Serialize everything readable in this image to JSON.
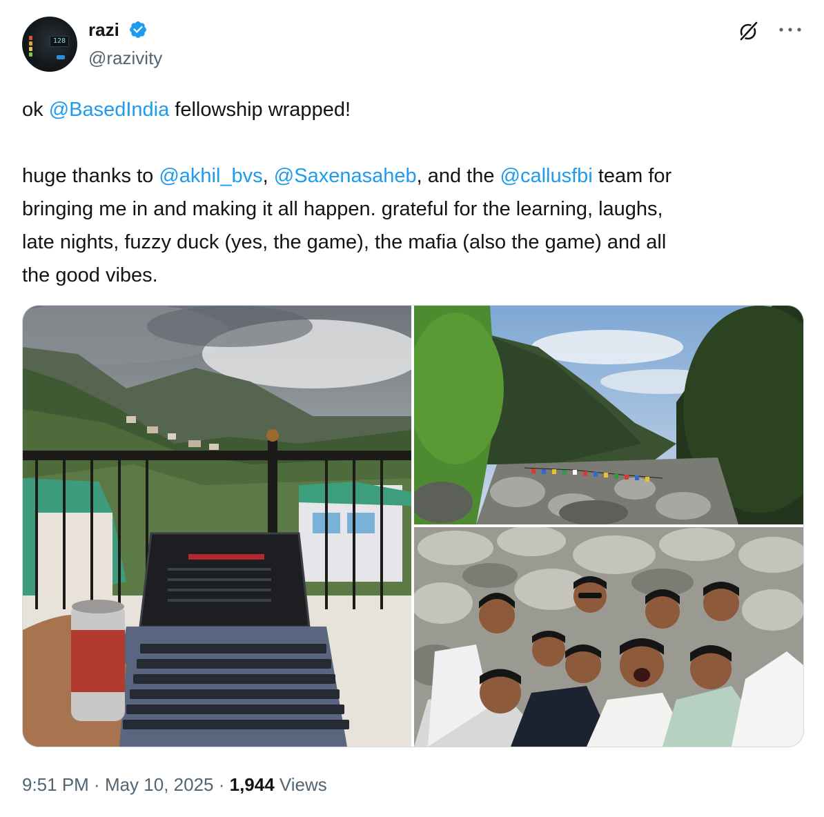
{
  "author": {
    "display_name": "razi",
    "handle": "@razivity",
    "verified": true,
    "avatar_readout": "128"
  },
  "header_actions": {
    "grok_icon": "grok-slash-circle-icon",
    "more_icon": "more-horizontal-icon"
  },
  "tweet": {
    "line1": {
      "pre": "ok ",
      "mention": "@BasedIndia",
      "post": " fellowship wrapped!"
    },
    "line2": {
      "pre": "huge thanks to ",
      "mention1": "@akhil_bvs",
      "sep1": ", ",
      "mention2": "@Saxenasaheb",
      "sep2": ", and the ",
      "mention3": "@callusfbi",
      "post": " team for"
    },
    "line3": "bringing me in and making it all happen. grateful for the learning, laughs,",
    "line4": "late nights, fuzzy duck (yes, the game), the mafia (also the game) and all",
    "line5": "the good vibes."
  },
  "media": [
    {
      "id": "photo-1",
      "subject": "balcony with laptop and soda can overlooking mountain town"
    },
    {
      "id": "photo-2",
      "subject": "forested mountain valley with rocky river and prayer flags"
    },
    {
      "id": "photo-3",
      "subject": "group selfie of friends on river rocks"
    }
  ],
  "meta": {
    "time": "9:51 PM",
    "dot1": " · ",
    "date": "May 10, 2025",
    "dot2": " · ",
    "views_count": "1,944",
    "views_label": " Views"
  },
  "colors": {
    "link": "#1d9bf0",
    "secondary_text": "#536471",
    "primary_text": "#0f1419",
    "border": "#cfd9de",
    "verified_badge": "#1d9bf0"
  }
}
